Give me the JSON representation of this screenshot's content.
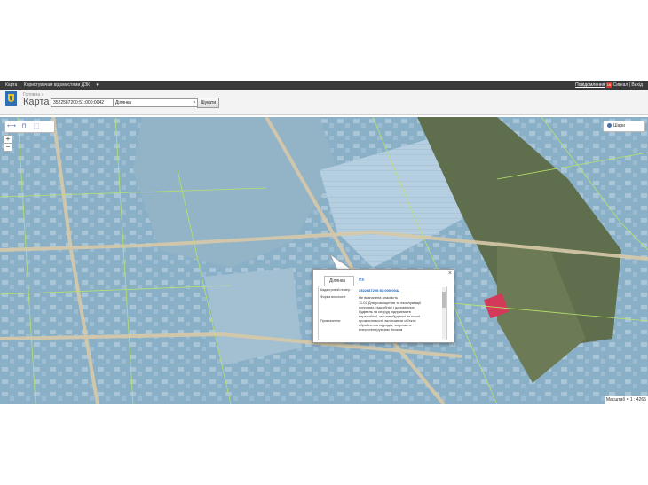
{
  "topbar": {
    "nav": [
      "Карта",
      "Користувачам відомостями ДЗК",
      "▾"
    ],
    "links": [
      "Повідомлення",
      "Сигнал",
      "Вихід"
    ],
    "badge": "16"
  },
  "header": {
    "breadcrumb": "Головна »",
    "title": "Карта",
    "cadastral_value": "3522587200:51:000:0042",
    "type_value": "Ділянка",
    "search_label": "Шукати"
  },
  "map": {
    "tools": [
      "ruler-icon",
      "area-icon",
      "select-icon"
    ],
    "zoom_in": "+",
    "zoom_out": "−",
    "layers_label": "Шари",
    "scale": "Масштаб = 1 : 4265"
  },
  "popup": {
    "tab_active": "Ділянка",
    "tab_other": "НК",
    "close": "×",
    "cad_label": "Кадастровий номер:",
    "cad_value": "3522587200:51:000:0042",
    "ownership_label": "Форма власності:",
    "ownership_value": "Не визначена власність",
    "purpose_label": "Призначення:",
    "purpose_lines": [
      "11.02 Для розміщення та експлуатації",
      "основних, підсобних і допоміжних",
      "будівель та споруд підприємств",
      "переробної, машинобудівної та іншої",
      "промисловості, включаючи об'єкти",
      "оброблення відходів, зокрема із",
      "енергогенеруючим блоком"
    ]
  }
}
